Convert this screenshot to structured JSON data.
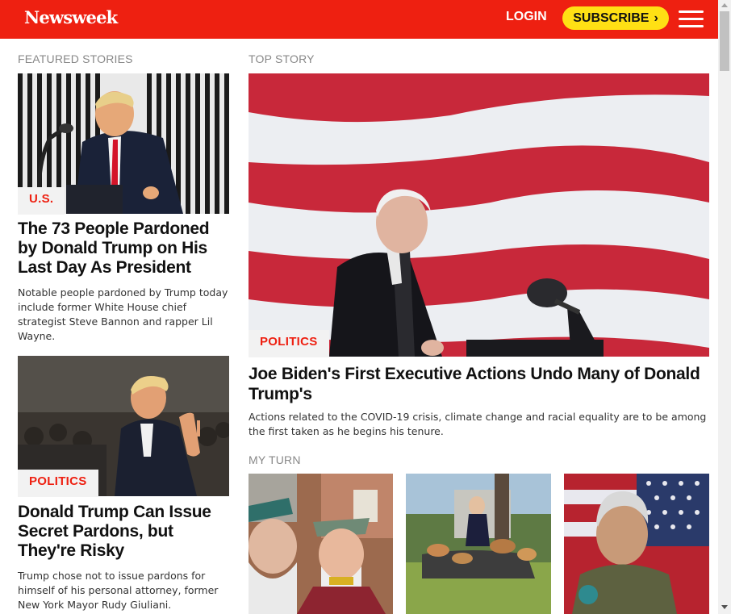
{
  "header": {
    "logo": "Newsweek",
    "login_label": "LOGIN",
    "subscribe_label": "SUBSCRIBE",
    "brand_color": "#ee2011",
    "subscribe_color": "#ffe014"
  },
  "featured": {
    "label": "FEATURED STORIES",
    "stories": [
      {
        "tag": "U.S.",
        "headline": "The 73 People Pardoned by Donald Trump on His Last Day As President",
        "summary": "Notable people pardoned by Trump today include former White House chief strategist Steve Bannon and rapper Lil Wayne."
      },
      {
        "tag": "POLITICS",
        "headline": "Donald Trump Can Issue Secret Pardons, but They're Risky",
        "summary": "Trump chose not to issue pardons for himself of his personal attorney, former New York Mayor Rudy Giuliani."
      }
    ]
  },
  "top_story": {
    "label": "TOP STORY",
    "tag": "POLITICS",
    "headline": "Joe Biden's First Executive Actions Undo Many of Donald Trump's",
    "summary": "Actions related to the COVID-19 crisis, climate change and racial equality are to be among the first taken as he begins his tenure."
  },
  "my_turn": {
    "label": "MY TURN"
  },
  "icons": {
    "menu": "hamburger-menu-icon",
    "subscribe_arrow": "chevron-right-icon"
  }
}
